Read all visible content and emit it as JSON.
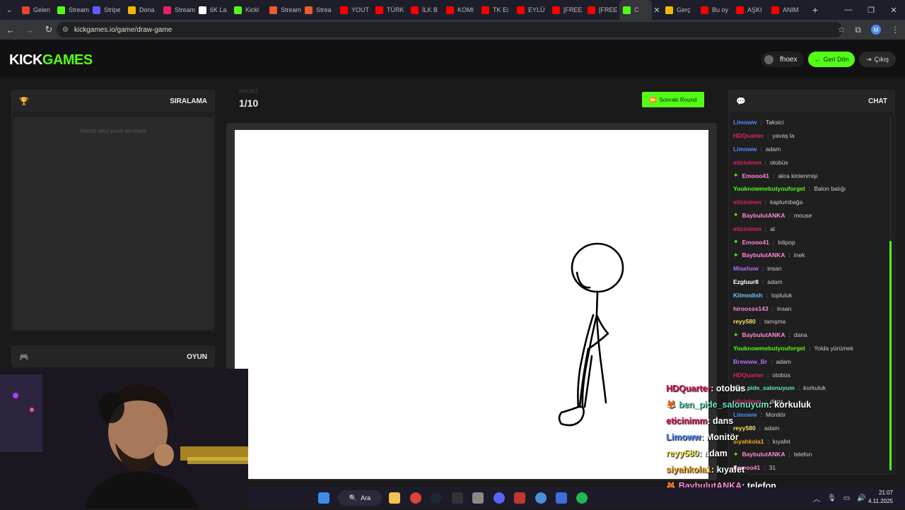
{
  "browser": {
    "tabs": [
      {
        "label": "Gelen",
        "color": "#ea4335"
      },
      {
        "label": "Stream",
        "color": "#53fc18"
      },
      {
        "label": "Stripe",
        "color": "#635bff"
      },
      {
        "label": "Dona",
        "color": "#f2b705"
      },
      {
        "label": "Stream",
        "color": "#e91e63"
      },
      {
        "label": "6K La",
        "color": "#ffffff"
      },
      {
        "label": "Kickl",
        "color": "#53fc18"
      },
      {
        "label": "Stream",
        "color": "#e85d2a"
      },
      {
        "label": "Strea",
        "color": "#e85d2a"
      },
      {
        "label": "YOUT",
        "color": "#ff0000"
      },
      {
        "label": "TÜRK",
        "color": "#ff0000"
      },
      {
        "label": "İLK B",
        "color": "#ff0000"
      },
      {
        "label": "KOMI",
        "color": "#ff0000"
      },
      {
        "label": "TK Ei",
        "color": "#ff0000"
      },
      {
        "label": "EYLÜ",
        "color": "#ff0000"
      },
      {
        "label": "[FREE",
        "color": "#ff0000"
      },
      {
        "label": "[FREE",
        "color": "#ff0000"
      }
    ],
    "active_tab": {
      "label": "C",
      "color": "#53fc18"
    },
    "tabs_after": [
      {
        "label": "Gerç",
        "color": "#f2b705"
      },
      {
        "label": "Bu oy",
        "color": "#ff0000"
      },
      {
        "label": "AŞKI",
        "color": "#ff0000"
      },
      {
        "label": "ANIM",
        "color": "#ff0000"
      }
    ],
    "url": "kickgames.io/game/draw-game"
  },
  "header": {
    "logo_kick": "KICK",
    "logo_games": "GAMES",
    "username": "fhoex",
    "back_label": "Geri Dön",
    "logout_label": "Çıkış"
  },
  "ranking": {
    "title": "SIRALAMA",
    "empty_text": "Henüz skor puan alınmadı"
  },
  "game_panel": {
    "title": "OYUN"
  },
  "round": {
    "label": "RAUNT",
    "count": "1/10"
  },
  "next_round_label": "Sonraki Round",
  "chat": {
    "title": "CHAT",
    "messages": [
      {
        "user": "Limoww",
        "color": "#4d8cff",
        "msg": "Taksici",
        "badge": false
      },
      {
        "user": "HDQuarter",
        "color": "#e0245e",
        "msg": "yavaş la",
        "badge": false
      },
      {
        "user": "Limoww",
        "color": "#4d8cff",
        "msg": "adam",
        "badge": false
      },
      {
        "user": "eticinimm",
        "color": "#e0245e",
        "msg": "otobüs",
        "badge": false
      },
      {
        "user": "Emooo41",
        "color": "#ff8ad8",
        "msg": "akra kinlenmişi",
        "badge": true
      },
      {
        "user": "Youknowmebutyouforget",
        "color": "#53fc18",
        "msg": "Balon balığı",
        "badge": false
      },
      {
        "user": "eticinimm",
        "color": "#e0245e",
        "msg": "kaplumbağa",
        "badge": false
      },
      {
        "user": "BaybulutANKA",
        "color": "#ff8ad8",
        "msg": "mouse",
        "badge": true
      },
      {
        "user": "eticinimm",
        "color": "#e0245e",
        "msg": "at",
        "badge": false
      },
      {
        "user": "Emooo41",
        "color": "#ff8ad8",
        "msg": "lolipop",
        "badge": true
      },
      {
        "user": "BaybulutANKA",
        "color": "#ff8ad8",
        "msg": "inek",
        "badge": true
      },
      {
        "user": "Miashow",
        "color": "#b36bff",
        "msg": "insan",
        "badge": false
      },
      {
        "user": "Ezgluur8",
        "color": "#ffffff",
        "msg": "adam",
        "badge": false
      },
      {
        "user": "Kitmodish",
        "color": "#6fc3ff",
        "msg": "topluluk",
        "badge": false
      },
      {
        "user": "hiroosss143",
        "color": "#ff8ad8",
        "msg": "insan",
        "badge": false
      },
      {
        "user": "reyy580",
        "color": "#f5e663",
        "msg": "tanışma",
        "badge": false
      },
      {
        "user": "BaybulutANKA",
        "color": "#ff8ad8",
        "msg": "dana",
        "badge": true
      },
      {
        "user": "Youknowmebutyouforget",
        "color": "#53fc18",
        "msg": "Yolda yürümek",
        "badge": false
      },
      {
        "user": "Brewww_Br",
        "color": "#b36bff",
        "msg": "adam",
        "badge": false
      },
      {
        "user": "HDQuarter",
        "color": "#e0245e",
        "msg": "otobüs",
        "badge": false
      },
      {
        "user": "ben_pide_salonuyum",
        "color": "#66e3c4",
        "msg": "korkuluk",
        "badge": false
      },
      {
        "user": "eticinimm",
        "color": "#e0245e",
        "msg": "dans",
        "badge": false
      },
      {
        "user": "Limoww",
        "color": "#4d8cff",
        "msg": "Monitör",
        "badge": false
      },
      {
        "user": "reyy580",
        "color": "#f5e663",
        "msg": "adam",
        "badge": false
      },
      {
        "user": "siyahkola1",
        "color": "#f5a623",
        "msg": "kıyafet",
        "badge": false
      },
      {
        "user": "BaybulutANKA",
        "color": "#ff8ad8",
        "msg": "telefon",
        "badge": true
      },
      {
        "user": "Emooo41",
        "color": "#ff8ad8",
        "msg": "31",
        "badge": false
      }
    ]
  },
  "overlay_chat": [
    {
      "user": "HDQuarter",
      "color": "#e0245e",
      "msg": "otobüs",
      "emoji": ""
    },
    {
      "user": "ben_pide_salonuyum",
      "color": "#66e3c4",
      "msg": "korkuluk",
      "emoji": "🦊"
    },
    {
      "user": "eticinimm",
      "color": "#e0245e",
      "msg": "dans",
      "emoji": ""
    },
    {
      "user": "Limoww",
      "color": "#4d8cff",
      "msg": "Monitör",
      "emoji": ""
    },
    {
      "user": "reyy580",
      "color": "#f5e663",
      "msg": "adam",
      "emoji": ""
    },
    {
      "user": "siyahkola1",
      "color": "#f5a623",
      "msg": "kıyafet",
      "emoji": ""
    },
    {
      "user": "BaybulutANKA",
      "color": "#ff8ad8",
      "msg": "telefon",
      "emoji": "🦊"
    },
    {
      "user": "Emooo41",
      "color": "#ff8ad8",
      "msg": "31",
      "emoji": "🦊"
    }
  ],
  "taskbar": {
    "search_label": "Ara",
    "time": "21:07",
    "date": "4.11.2025"
  },
  "colors": {
    "accent": "#53fc18",
    "bg": "#1a1a1a",
    "panel": "#1f1f1f"
  }
}
